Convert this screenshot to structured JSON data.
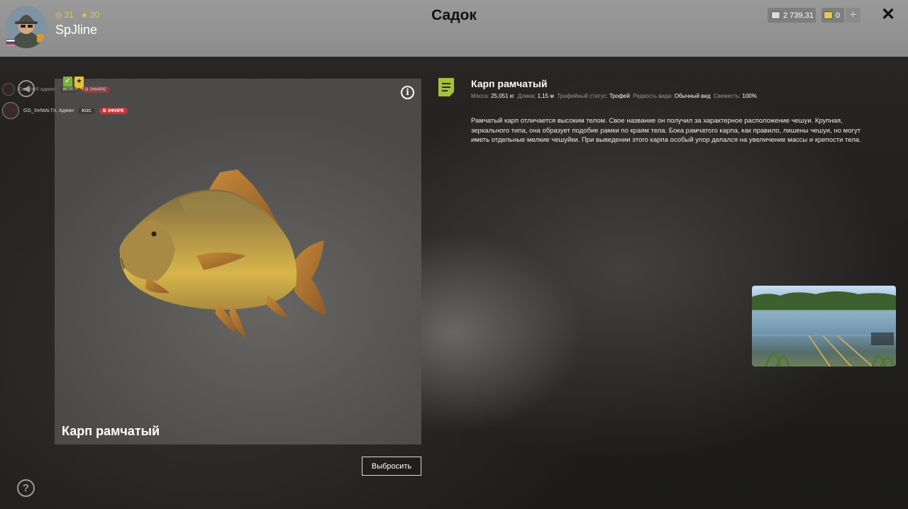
{
  "header": {
    "title": "Садок",
    "player": {
      "name": "SpJline",
      "level": "31",
      "rank": "20"
    },
    "currency": {
      "silver": "2 739,31",
      "gold": "0"
    },
    "plus_label": "+",
    "close_label": "✕"
  },
  "fish_card": {
    "title": "Карп рамчатый",
    "info_label": "i",
    "discard_label": "Выбросить"
  },
  "stream_overlay": {
    "rows": [
      {
        "name": "DexXteR админ",
        "channel": "WOT",
        "live_label": "В ЭФИРЕ"
      },
      {
        "name": "GG_XeNtAi Гл. Админ",
        "channel": "КОС",
        "live_label": "В ЭФИРЕ"
      }
    ]
  },
  "fish_info": {
    "name": "Карп рамчатый",
    "meta": {
      "mass_label": "Масса:",
      "mass": "25,051 кг",
      "length_label": "Длина:",
      "length": "1,15 м",
      "trophy_label": "Трофейный статус:",
      "trophy": "Трофей",
      "rarity_label": "Редкость вида:",
      "rarity": "Обычный вид",
      "fresh_label": "Свежесть:",
      "fresh": "100%"
    },
    "description": "Рамчатый карп отличается высоким телом. Свое название он получил за характерное расположение чешуи. Крупная, зеркального типа, она образует подобие рамки по краям тела. Бока рамчатого карпа, как правило, лишены чешуи, но могут иметь отдельные мелкие чешуйки. При выведении этого карпа особый упор делался на увеличение массы и крепости тела."
  },
  "help_label": "?",
  "colors": {
    "accent_green": "#a6c13a",
    "live_red": "#c6353b",
    "gold": "#e2c64a"
  }
}
